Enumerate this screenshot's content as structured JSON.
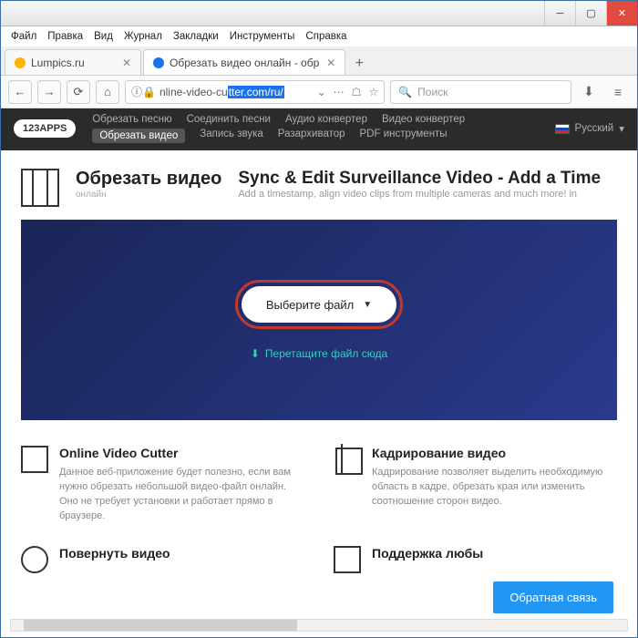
{
  "menubar": [
    "Файл",
    "Правка",
    "Вид",
    "Журнал",
    "Закладки",
    "Инструменты",
    "Справка"
  ],
  "tabs": [
    {
      "title": "Lumpics.ru",
      "favcolor": "#ffb400"
    },
    {
      "title": "Обрезать видео онлайн - обр",
      "favcolor": "#1a73e8"
    }
  ],
  "url": {
    "pre": "nline-video-cu",
    "hl": "tter.com/ru/"
  },
  "search_placeholder": "Поиск",
  "app": {
    "logo": "123APPS",
    "menu": [
      "Обрезать песню",
      "Соединить песни",
      "Аудио конвертер",
      "Видео конвертер",
      "Обрезать видео",
      "Запись звука",
      "Разархиватор",
      "PDF инструменты"
    ],
    "active": "Обрезать видео",
    "lang": "Русский"
  },
  "header": {
    "title": "Обрезать видео",
    "sub": "онлайн"
  },
  "ad": {
    "title": "Sync & Edit Surveillance Video - Add a Time",
    "sub": "Add a timestamp, align video clips from multiple cameras and much more! in"
  },
  "hero": {
    "button": "Выберите файл",
    "hint": "Перетащите файл сюда"
  },
  "features": [
    {
      "title": "Online Video Cutter",
      "text": "Данное веб-приложение будет полезно, если вам нужно обрезать небольшой видео-файл онлайн. Оно не требует установки и работает прямо в браузере."
    },
    {
      "title": "Кадрирование видео",
      "text": "Кадрирование позволяет выделить необходимую область в кадре, обрезать края или изменить соотношение сторон видео."
    }
  ],
  "features2": [
    {
      "title": "Повернуть видео"
    },
    {
      "title": "Поддержка любы"
    }
  ],
  "feedback": "Обратная связь"
}
